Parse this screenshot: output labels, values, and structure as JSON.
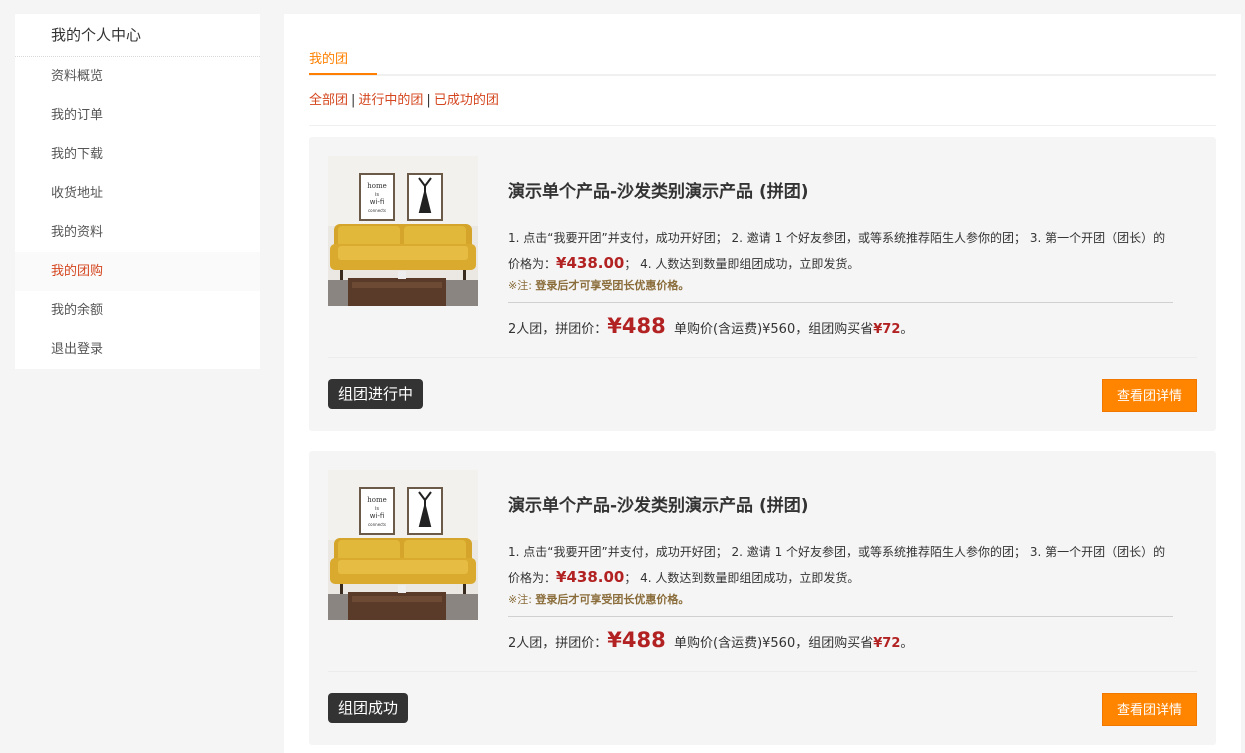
{
  "sidebar": {
    "title": "我的个人中心",
    "items": [
      {
        "label": "资料概览"
      },
      {
        "label": "我的订单"
      },
      {
        "label": "我的下载"
      },
      {
        "label": "收货地址"
      },
      {
        "label": "我的资料"
      },
      {
        "label": "我的团购",
        "active": true
      },
      {
        "label": "我的余额"
      },
      {
        "label": "退出登录"
      }
    ]
  },
  "main": {
    "tab": "我的团",
    "filters": {
      "all": "全部团",
      "sep": "|",
      "in_progress": "进行中的团",
      "success": "已成功的团"
    },
    "cards": [
      {
        "title": "演示单个产品-沙发类别演示产品 (拼团)",
        "desc_part1": "1. 点击“我要开团”并支付，成功开好团； 2. 邀请 1 个好友参团，或等系统推荐陌生人参你的团； 3. 第一个开团（团长）的价格为：",
        "desc_price": "¥438.00",
        "desc_part2": "； 4. 人数达到数量即组团成功，立即发货。",
        "note_prefix": "※注: ",
        "note_text": "登录后才可享受团长优惠价格。",
        "price_prefix": "2人团，拼团价：",
        "group_price": "¥488",
        "single_text": "单购价(含运费)¥560，组团购买省",
        "saving": "¥72",
        "saving_suffix": "。",
        "status": "组团进行中",
        "button": "查看团详情"
      },
      {
        "title": "演示单个产品-沙发类别演示产品 (拼团)",
        "desc_part1": "1. 点击“我要开团”并支付，成功开好团； 2. 邀请 1 个好友参团，或等系统推荐陌生人参你的团； 3. 第一个开团（团长）的价格为：",
        "desc_price": "¥438.00",
        "desc_part2": "； 4. 人数达到数量即组团成功，立即发货。",
        "note_prefix": "※注: ",
        "note_text": "登录后才可享受团长优惠价格。",
        "price_prefix": "2人团，拼团价：",
        "group_price": "¥488",
        "single_text": "单购价(含运费)¥560，组团购买省",
        "saving": "¥72",
        "saving_suffix": "。",
        "status": "组团成功",
        "button": "查看团详情"
      }
    ]
  },
  "colors": {
    "accent": "#ff8400",
    "active_link": "#d4461f",
    "price": "#b22222"
  },
  "product_image": {
    "poster_left_text": [
      "home",
      "is",
      "wi-fi",
      "connects"
    ]
  }
}
